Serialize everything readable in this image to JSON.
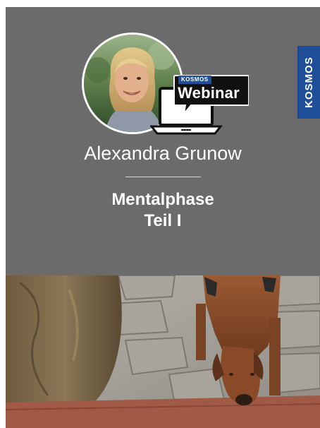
{
  "brand": {
    "name": "KOSMOS"
  },
  "webinar": {
    "brand": "KOSMOS",
    "label": "Webinar"
  },
  "author": {
    "name": "Alexandra Grunow"
  },
  "session": {
    "title_line1": "Mentalphase",
    "title_line2": "Teil I"
  },
  "icons": [
    "kosmos-logo-icon",
    "laptop-icon",
    "speech-bubble-icon"
  ],
  "colors": {
    "panel_bg": "#6b6b6b",
    "brand_blue": "#1f4e9b",
    "text_white": "#ffffff"
  }
}
